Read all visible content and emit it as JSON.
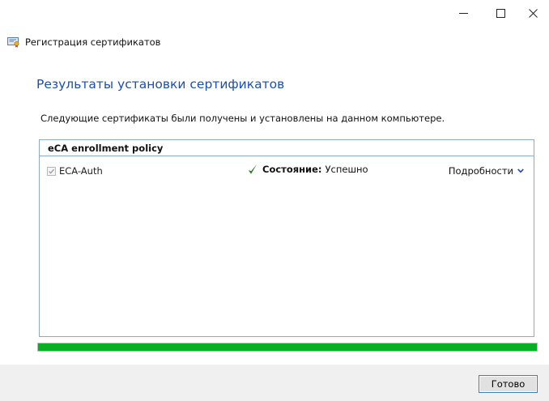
{
  "window": {
    "title": "Регистрация сертификатов",
    "controls": {
      "minimize_icon": "minimize-icon",
      "maximize_icon": "maximize-icon",
      "close_icon": "close-icon"
    }
  },
  "main": {
    "heading": "Результаты установки сертификатов",
    "description": "Следующие сертификаты были получены и установлены на данном компьютере."
  },
  "policy": {
    "name": "eCA enrollment policy",
    "certificates": [
      {
        "name": "ECA-Auth",
        "checked": true,
        "status_label": "Состояние:",
        "status_value": "Успешно",
        "status_icon": "checkmark-icon",
        "details_label": "Подробности",
        "details_icon": "chevron-down-icon"
      }
    ]
  },
  "progress": {
    "fraction": 1.0,
    "color": "#06b025"
  },
  "footer": {
    "done_label": "Готово"
  },
  "colors": {
    "heading": "#1d4fa6",
    "panel_border": "#8aa9cc",
    "footer_bg": "#f0f0f0"
  }
}
